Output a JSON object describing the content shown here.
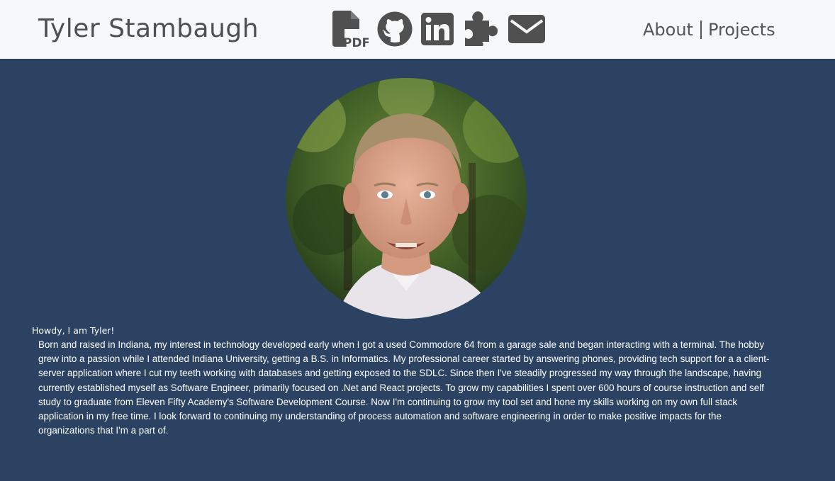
{
  "header": {
    "name": "Tyler Stambaugh",
    "icons": [
      "pdf-resume-icon",
      "github-icon",
      "linkedin-icon",
      "puzzle-piece-icon",
      "envelope-icon"
    ],
    "icon_color": "#505050",
    "nav": {
      "about": "About",
      "projects": "Projects"
    }
  },
  "colors": {
    "header_bg": "#f7f8fa",
    "page_bg": "#2b4263",
    "text": "#ffffff"
  },
  "main": {
    "greeting": "Howdy, I am Tyler!",
    "bio": "Born and raised in Indiana, my interest in technology developed early when I got a used Commodore 64 from a garage sale and began interacting with a terminal. The hobby grew into a passion while I attended Indiana University, getting a B.S. in Informatics. My professional career started by answering phones, providing tech support for a a client-server application where I cut my teeth working with databases and getting exposed to the SDLC. Since then I've steadily progressed my way through the landscape, having currently established myself as Software Engineer, primarily focused on .Net and React projects. To grow my capabilities I spent over 600 hours of course instruction and self study to graduate from Eleven Fifty Academy's Software Development Course. Now I'm continuing to grow my tool set and hone my skills working on my own full stack application in my free time. I look forward to continuing my understanding of process automation and software engineering in order to make positive impacts for the organizations that I'm a part of."
  }
}
